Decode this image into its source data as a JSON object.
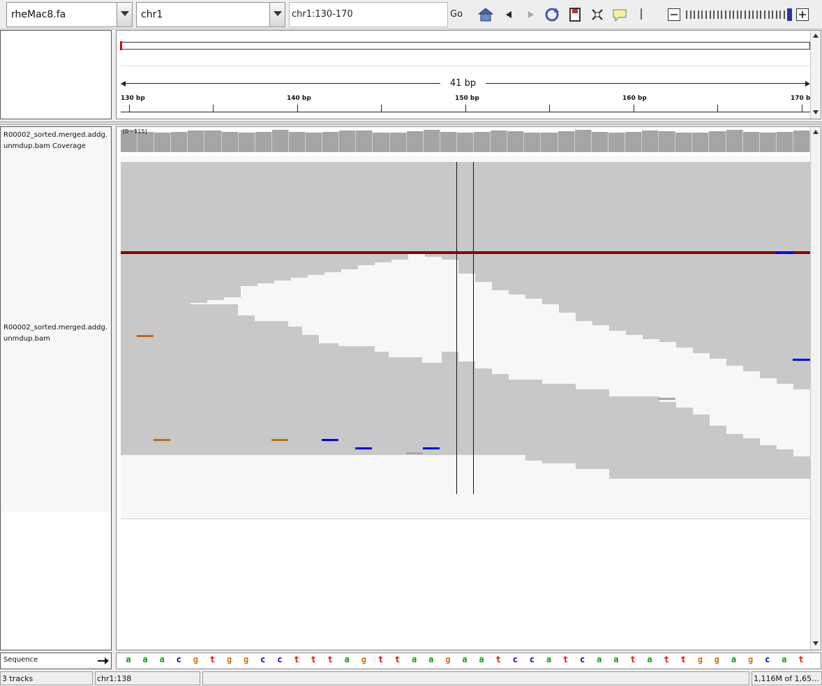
{
  "toolbar": {
    "genome": "rheMac8.fa",
    "chromosome": "chr1",
    "locus": "chr1:130-170",
    "go_label": "Go"
  },
  "ruler": {
    "span_label": "41 bp",
    "ticks": [
      "130 bp",
      "140 bp",
      "150 bp",
      "160 bp",
      "170 bp"
    ]
  },
  "tracks": {
    "coverage_name": "R00002_sorted.merged.addg.unmdup.bam Coverage",
    "coverage_range": "[0 - 115]",
    "alignment_name": "R00002_sorted.merged.addg.unmdup.bam",
    "sequence_name": "Sequence"
  },
  "sequence": {
    "bases": [
      "a",
      "a",
      "a",
      "c",
      "g",
      "t",
      "g",
      "g",
      "c",
      "c",
      "t",
      "t",
      "t",
      "a",
      "g",
      "t",
      "t",
      "a",
      "a",
      "g",
      "a",
      "a",
      "t",
      "c",
      "c",
      "a",
      "t",
      "c",
      "a",
      "a",
      "t",
      "a",
      "t",
      "t",
      "g",
      "g",
      "a",
      "g",
      "c",
      "a",
      "t"
    ],
    "colors": {
      "a": "#00a000",
      "c": "#0000c8",
      "g": "#d17105",
      "t": "#ff0000"
    }
  },
  "status": {
    "tracks": "3 tracks",
    "position": "chr1:138",
    "memory": "1,116M of 1,65..."
  }
}
